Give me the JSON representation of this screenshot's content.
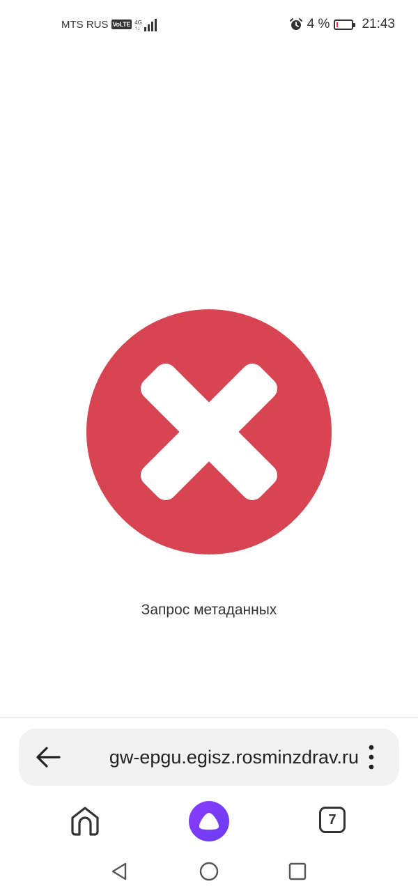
{
  "status_bar": {
    "carrier": "MTS RUS",
    "volte": "VoLTE",
    "network_type_top": "4G",
    "network_type_bottom": "↑↓",
    "battery_percent": "4 %",
    "time": "21:43",
    "icons": [
      "alarm-icon",
      "battery-icon",
      "signal-icon"
    ]
  },
  "main": {
    "status_icon": "error-x-icon",
    "error_color": "#d94452",
    "message": "Запрос метаданных"
  },
  "browser": {
    "url": "gw-epgu.egisz.rosminzdrav.ru",
    "tab_count": "7",
    "accent_color": "#7b3cff"
  },
  "navigation": {
    "icons": [
      "back-arrow-icon",
      "more-vert-icon",
      "home-icon",
      "alice-icon",
      "tabs-icon",
      "system-back-icon",
      "system-home-icon",
      "system-recent-icon"
    ]
  }
}
